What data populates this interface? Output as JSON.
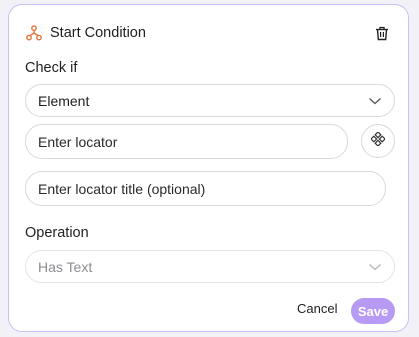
{
  "header": {
    "title": "Start Condition",
    "icon": "flow-branch-icon",
    "icon_color": "#e8743b",
    "delete_icon": "trash-icon"
  },
  "check_if": {
    "label": "Check if",
    "type_value": "Element",
    "locator_placeholder": "Enter locator",
    "locator_title_placeholder": "Enter locator title (optional)",
    "picker_icon": "element-picker-icon"
  },
  "operation": {
    "label": "Operation",
    "value": "Has Text",
    "disabled": true
  },
  "footer": {
    "cancel_label": "Cancel",
    "save_label": "Save",
    "save_color": "#b79af3"
  },
  "theme": {
    "card_border": "#cbbff5",
    "field_border": "#d9d9de"
  }
}
